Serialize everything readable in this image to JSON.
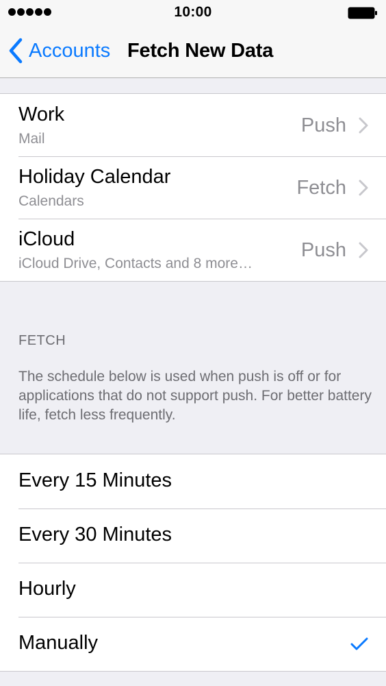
{
  "status_bar": {
    "time": "10:00",
    "signal_icon": "signal-dots-icon",
    "battery_icon": "battery-icon"
  },
  "nav": {
    "back_label": "Accounts",
    "back_icon": "chevron-left-icon",
    "title": "Fetch New Data"
  },
  "accounts": [
    {
      "name": "Work",
      "subtitle": "Mail",
      "value": "Push"
    },
    {
      "name": "Holiday Calendar",
      "subtitle": "Calendars",
      "value": "Fetch"
    },
    {
      "name": "iCloud",
      "subtitle": "iCloud Drive, Contacts and 8 more…",
      "value": "Push"
    }
  ],
  "fetch_section": {
    "header": "FETCH",
    "footer": "The schedule below is used when push is off or for applications that do not support push. For better battery life, fetch less frequently."
  },
  "schedule_options": [
    {
      "label": "Every 15 Minutes",
      "selected": false
    },
    {
      "label": "Every 30 Minutes",
      "selected": false
    },
    {
      "label": "Hourly",
      "selected": false
    },
    {
      "label": "Manually",
      "selected": true
    }
  ],
  "colors": {
    "accent": "#0a7aff",
    "background": "#efeff4",
    "secondary_text": "#8e8e93"
  }
}
